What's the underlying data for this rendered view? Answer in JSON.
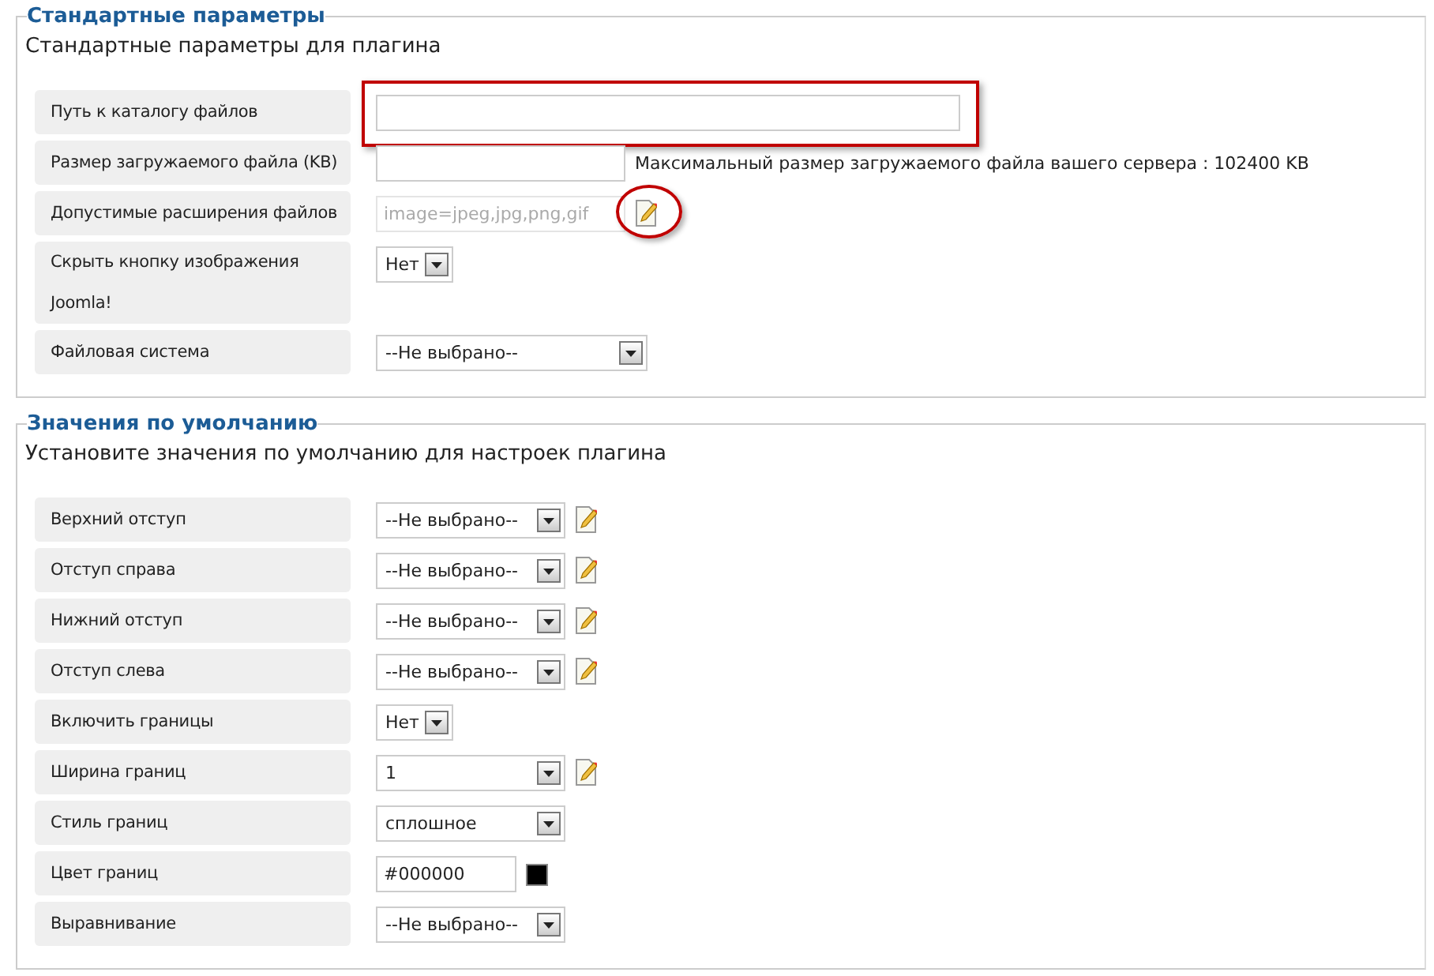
{
  "sections": [
    {
      "title": "Стандартные параметры",
      "description": "Стандартные параметры для плагина",
      "rows": [
        {
          "label": "Путь к каталогу файлов",
          "kind": "text",
          "value": "",
          "highlighted": true
        },
        {
          "label": "Размер загружаемого файла (KB)",
          "kind": "text",
          "value": "",
          "note": "Максимальный размер загружаемого файла вашего сервера : 102400 KB"
        },
        {
          "label": "Допустимые расширения файлов",
          "kind": "readonly",
          "value": "image=jpeg,jpg,png,gif",
          "disabled": true,
          "editable": true,
          "highlighted": true
        },
        {
          "label": "Скрыть кнопку изображения Joomla!",
          "kind": "toggle",
          "value": "Нет"
        },
        {
          "label": "Файловая система",
          "kind": "select",
          "value": "--Не выбрано--"
        }
      ]
    },
    {
      "title": "Значения по умолчанию",
      "description": "Установите значения по умолчанию для настроек плагина",
      "rows": [
        {
          "label": "Верхний отступ",
          "kind": "select",
          "value": "--Не выбрано--",
          "editable": true
        },
        {
          "label": "Отступ справа",
          "kind": "select",
          "value": "--Не выбрано--",
          "editable": true
        },
        {
          "label": "Нижний отступ",
          "kind": "select",
          "value": "--Не выбрано--",
          "editable": true
        },
        {
          "label": "Отступ слева",
          "kind": "select",
          "value": "--Не выбрано--",
          "editable": true
        },
        {
          "label": "Включить границы",
          "kind": "toggle",
          "value": "Нет"
        },
        {
          "label": "Ширина границ",
          "kind": "select",
          "value": "1",
          "editable": true
        },
        {
          "label": "Стиль границ",
          "kind": "select",
          "value": "сплошное"
        },
        {
          "label": "Цвет границ",
          "kind": "color",
          "value": "#000000",
          "color": "#000000"
        },
        {
          "label": "Выравнивание",
          "kind": "select",
          "value": "--Не выбрано--"
        }
      ]
    }
  ]
}
